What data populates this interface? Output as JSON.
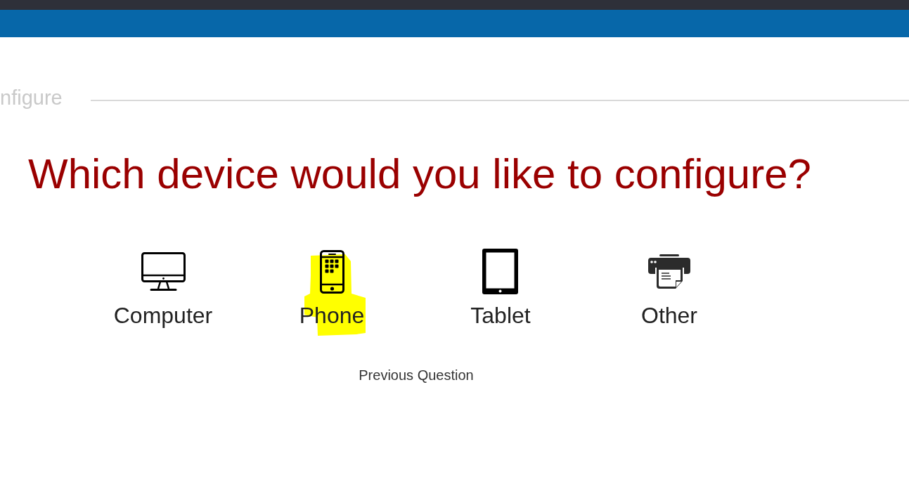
{
  "breadcrumb": {
    "title": "nfigure"
  },
  "question": {
    "text": "Which device would you like to configure?"
  },
  "options": [
    {
      "label": "Computer",
      "kind": "computer",
      "highlighted": false
    },
    {
      "label": "Phone",
      "kind": "phone",
      "highlighted": true
    },
    {
      "label": "Tablet",
      "kind": "tablet",
      "highlighted": false
    },
    {
      "label": "Other",
      "kind": "printer",
      "highlighted": false
    }
  ],
  "previous_button": {
    "label": "Previous Question"
  }
}
